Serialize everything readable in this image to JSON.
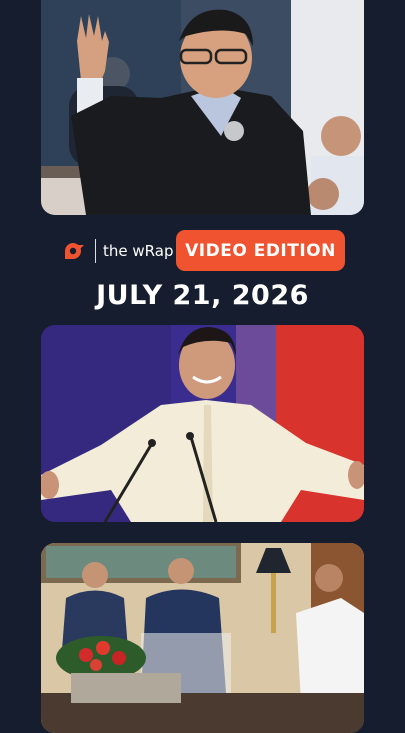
{
  "brand": {
    "logo_icon": "rappler-logo-icon",
    "name": "the wRap",
    "badge": "VIDEO EDITION",
    "accent": "#f0532f"
  },
  "edition_date": "JULY 21, 2026",
  "colors": {
    "background": "#161d2e",
    "text": "#ffffff"
  },
  "photos": [
    {
      "subject": "official-taking-oath-photo"
    },
    {
      "subject": "official-arms-spread-photo"
    },
    {
      "subject": "meeting-photo"
    }
  ]
}
